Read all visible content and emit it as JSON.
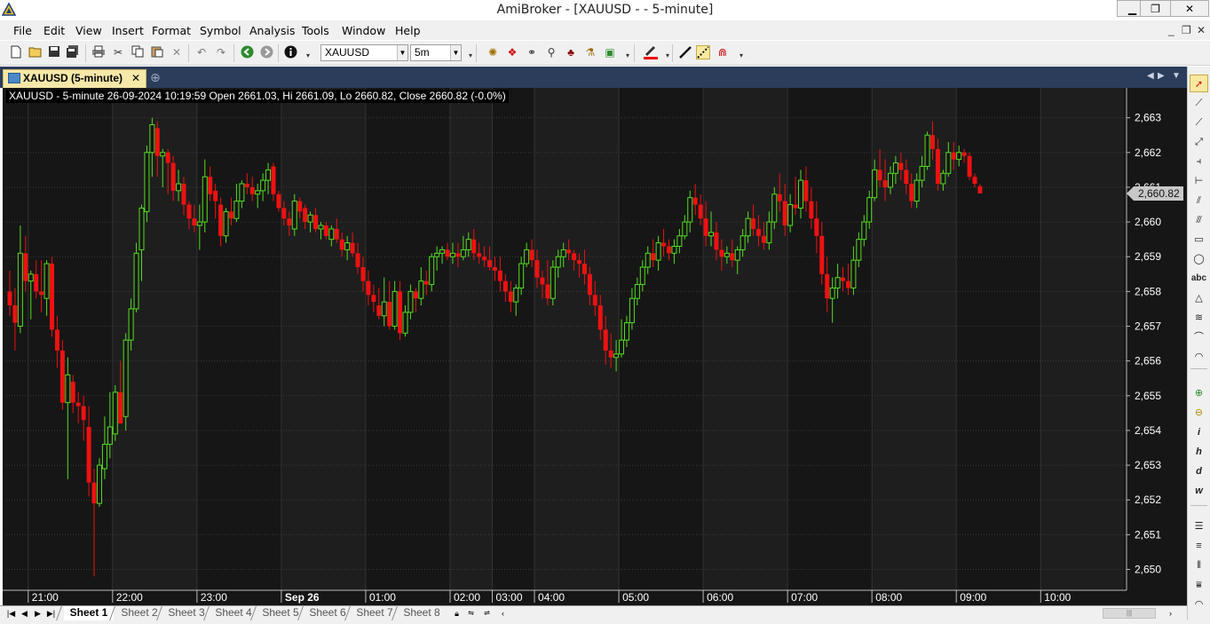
{
  "window": {
    "title": "AmiBroker - [XAUUSD -  - 5-minute]",
    "minimize": "▁",
    "restore": "❐",
    "close": "✕"
  },
  "menu": {
    "items": [
      "File",
      "Edit",
      "View",
      "Insert",
      "Format",
      "Symbol",
      "Analysis",
      "Tools",
      "Window",
      "Help"
    ],
    "mdi_minimize": "_",
    "mdi_restore": "❐",
    "mdi_close": "✕"
  },
  "toolbar": {
    "symbol": "XAUUSD",
    "interval": "5m"
  },
  "tabs": {
    "active_label": "XAUUSD (5-minute)",
    "close": "✕",
    "add": "⊕"
  },
  "chart_header": {
    "ohlc": "XAUUSD - 5-minute 26-09-2024 10:19:59 Open 2661.03, Hi 2661.09, Lo 2660.82, Close 2660.82 (-0.0%)"
  },
  "chart_data": {
    "type": "candlestick",
    "symbol": "XAUUSD",
    "interval": "5-minute",
    "ylim": [
      2649.4,
      2663.4
    ],
    "yticks": [
      2650,
      2651,
      2652,
      2653,
      2654,
      2655,
      2656,
      2657,
      2658,
      2659,
      2660,
      2661,
      2662,
      2663
    ],
    "ytick_labels": [
      "2,650",
      "2,651",
      "2,652",
      "2,653",
      "2,654",
      "2,655",
      "2,656",
      "2,657",
      "2,658",
      "2,659",
      "2,660",
      "2,661",
      "2,662",
      "2,663"
    ],
    "last_price_label": "2,660.82",
    "last_price": 2660.82,
    "xtick_labels": [
      "21:00",
      "22:00",
      "23:00",
      "Sep 26",
      "01:00",
      "02:00",
      "03:00",
      "04:00",
      "05:00",
      "06:00",
      "07:00",
      "08:00",
      "09:00",
      "10:00"
    ],
    "xtick_bar_index": [
      4,
      20,
      36,
      52,
      68,
      84,
      92,
      100,
      116,
      132,
      148,
      164,
      180,
      196
    ],
    "up_color": "#55dd22",
    "down_color": "#ee1111",
    "background": "#161616",
    "grid": true,
    "candles": [
      [
        2658.0,
        2658.6,
        2657.3,
        2657.6
      ],
      [
        2657.6,
        2658.1,
        2656.3,
        2657.1
      ],
      [
        2657.0,
        2659.9,
        2656.8,
        2659.1
      ],
      [
        2659.1,
        2659.6,
        2658.0,
        2658.3
      ],
      [
        2658.3,
        2658.6,
        2657.2,
        2658.5
      ],
      [
        2658.5,
        2658.9,
        2657.8,
        2658.0
      ],
      [
        2658.0,
        2658.9,
        2657.4,
        2657.9
      ],
      [
        2657.8,
        2658.9,
        2657.3,
        2658.8
      ],
      [
        2658.8,
        2659.0,
        2656.7,
        2656.9
      ],
      [
        2656.9,
        2657.3,
        2655.8,
        2656.3
      ],
      [
        2656.3,
        2656.6,
        2654.6,
        2654.8
      ],
      [
        2654.8,
        2656.1,
        2652.6,
        2655.6
      ],
      [
        2655.4,
        2655.6,
        2654.5,
        2654.8
      ],
      [
        2654.8,
        2655.1,
        2654.2,
        2654.7
      ],
      [
        2654.7,
        2655.0,
        2653.7,
        2654.3
      ],
      [
        2654.1,
        2654.7,
        2652.1,
        2652.5
      ],
      [
        2652.5,
        2652.9,
        2649.8,
        2651.9
      ],
      [
        2651.9,
        2653.2,
        2651.8,
        2653.0
      ],
      [
        2652.9,
        2654.4,
        2652.6,
        2653.6
      ],
      [
        2653.6,
        2655.1,
        2653.2,
        2654.1
      ],
      [
        2653.9,
        2655.3,
        2653.7,
        2655.1
      ],
      [
        2655.1,
        2656.0,
        2654.2,
        2654.2
      ],
      [
        2654.4,
        2656.8,
        2654.0,
        2656.6
      ],
      [
        2656.6,
        2657.8,
        2656.3,
        2657.5
      ],
      [
        2657.5,
        2659.4,
        2657.4,
        2659.1
      ],
      [
        2659.2,
        2660.5,
        2658.3,
        2660.4
      ],
      [
        2660.3,
        2662.2,
        2660.0,
        2662.0
      ],
      [
        2662.0,
        2663.0,
        2661.3,
        2662.8
      ],
      [
        2662.7,
        2662.9,
        2661.3,
        2661.9
      ],
      [
        2661.9,
        2662.1,
        2661.0,
        2662.0
      ],
      [
        2662.0,
        2662.1,
        2660.8,
        2661.7
      ],
      [
        2661.7,
        2661.9,
        2660.6,
        2660.9
      ],
      [
        2660.9,
        2661.5,
        2660.6,
        2661.1
      ],
      [
        2661.1,
        2661.3,
        2660.2,
        2660.5
      ],
      [
        2660.5,
        2660.6,
        2659.8,
        2660.1
      ],
      [
        2660.1,
        2660.5,
        2659.7,
        2659.9
      ],
      [
        2659.9,
        2660.5,
        2659.2,
        2660.0
      ],
      [
        2660.0,
        2661.8,
        2659.7,
        2661.3
      ],
      [
        2661.3,
        2661.6,
        2660.6,
        2660.8
      ],
      [
        2660.9,
        2661.1,
        2660.1,
        2660.6
      ],
      [
        2660.5,
        2660.7,
        2659.3,
        2659.6
      ],
      [
        2659.6,
        2660.4,
        2659.4,
        2660.3
      ],
      [
        2660.3,
        2660.7,
        2659.9,
        2660.1
      ],
      [
        2660.1,
        2661.1,
        2660.0,
        2660.6
      ],
      [
        2660.6,
        2661.2,
        2660.4,
        2661.1
      ],
      [
        2661.1,
        2661.4,
        2660.8,
        2661.0
      ],
      [
        2661.0,
        2661.3,
        2660.6,
        2660.8
      ],
      [
        2660.8,
        2661.1,
        2660.4,
        2660.9
      ],
      [
        2660.9,
        2661.4,
        2660.6,
        2661.2
      ],
      [
        2661.2,
        2661.7,
        2660.8,
        2661.5
      ],
      [
        2661.6,
        2661.7,
        2660.6,
        2660.8
      ],
      [
        2660.8,
        2660.9,
        2660.3,
        2660.4
      ],
      [
        2660.4,
        2660.6,
        2659.9,
        2660.1
      ],
      [
        2660.1,
        2660.3,
        2659.6,
        2659.9
      ],
      [
        2659.8,
        2660.8,
        2659.6,
        2660.6
      ],
      [
        2660.6,
        2660.7,
        2660.1,
        2660.3
      ],
      [
        2660.4,
        2660.5,
        2659.8,
        2660.0
      ],
      [
        2660.0,
        2660.3,
        2659.7,
        2660.2
      ],
      [
        2660.2,
        2660.4,
        2659.7,
        2659.8
      ],
      [
        2659.8,
        2660.0,
        2659.5,
        2659.9
      ],
      [
        2659.9,
        2660.0,
        2659.5,
        2659.6
      ],
      [
        2659.5,
        2659.9,
        2659.3,
        2659.8
      ],
      [
        2659.8,
        2660.1,
        2659.4,
        2659.5
      ],
      [
        2659.5,
        2659.7,
        2659.0,
        2659.2
      ],
      [
        2659.2,
        2659.6,
        2658.9,
        2659.4
      ],
      [
        2659.4,
        2659.7,
        2659.0,
        2659.1
      ],
      [
        2659.1,
        2659.4,
        2658.5,
        2658.7
      ],
      [
        2658.7,
        2659.0,
        2658.0,
        2658.3
      ],
      [
        2658.3,
        2658.6,
        2657.6,
        2657.9
      ],
      [
        2657.9,
        2658.2,
        2657.4,
        2657.7
      ],
      [
        2657.6,
        2658.1,
        2657.2,
        2657.3
      ],
      [
        2657.3,
        2658.4,
        2657.0,
        2657.7
      ],
      [
        2657.7,
        2658.3,
        2656.9,
        2657.0
      ],
      [
        2657.0,
        2658.3,
        2656.9,
        2658.0
      ],
      [
        2658.0,
        2658.3,
        2656.6,
        2656.8
      ],
      [
        2656.8,
        2657.6,
        2656.7,
        2657.4
      ],
      [
        2657.4,
        2658.2,
        2657.2,
        2658.0
      ],
      [
        2658.0,
        2658.1,
        2657.4,
        2657.8
      ],
      [
        2657.8,
        2658.7,
        2657.6,
        2658.3
      ],
      [
        2658.3,
        2658.6,
        2657.9,
        2658.2
      ],
      [
        2658.2,
        2659.1,
        2658.0,
        2659.0
      ],
      [
        2659.0,
        2659.3,
        2658.6,
        2659.1
      ],
      [
        2659.1,
        2659.3,
        2658.8,
        2659.2
      ],
      [
        2659.2,
        2659.4,
        2658.9,
        2659.0
      ],
      [
        2659.0,
        2659.4,
        2658.8,
        2659.1
      ],
      [
        2659.1,
        2659.4,
        2658.7,
        2659.0
      ],
      [
        2659.0,
        2659.6,
        2658.9,
        2659.2
      ],
      [
        2659.2,
        2659.7,
        2659.0,
        2659.5
      ],
      [
        2659.5,
        2659.8,
        2658.9,
        2659.1
      ],
      [
        2659.1,
        2659.4,
        2658.8,
        2659.0
      ],
      [
        2659.0,
        2659.3,
        2658.7,
        2658.9
      ],
      [
        2658.9,
        2659.3,
        2658.6,
        2658.7
      ],
      [
        2658.7,
        2659.0,
        2658.3,
        2658.6
      ],
      [
        2658.6,
        2659.0,
        2658.0,
        2658.3
      ],
      [
        2658.3,
        2658.5,
        2657.7,
        2658.0
      ],
      [
        2658.0,
        2658.3,
        2657.4,
        2657.7
      ],
      [
        2657.7,
        2658.2,
        2657.3,
        2658.1
      ],
      [
        2658.1,
        2659.0,
        2657.9,
        2658.8
      ],
      [
        2658.8,
        2659.4,
        2658.7,
        2659.2
      ],
      [
        2659.2,
        2659.5,
        2658.7,
        2658.9
      ],
      [
        2658.9,
        2659.2,
        2658.1,
        2658.4
      ],
      [
        2658.4,
        2658.6,
        2657.8,
        2658.2
      ],
      [
        2658.2,
        2658.9,
        2657.6,
        2657.8
      ],
      [
        2657.8,
        2658.9,
        2657.6,
        2658.7
      ],
      [
        2658.7,
        2659.2,
        2658.4,
        2659.0
      ],
      [
        2659.0,
        2659.4,
        2658.7,
        2659.2
      ],
      [
        2659.2,
        2659.5,
        2658.9,
        2659.1
      ],
      [
        2659.1,
        2659.2,
        2658.6,
        2658.9
      ],
      [
        2658.9,
        2659.1,
        2658.4,
        2658.8
      ],
      [
        2658.8,
        2659.2,
        2658.2,
        2658.5
      ],
      [
        2658.5,
        2658.7,
        2657.6,
        2657.9
      ],
      [
        2657.9,
        2658.3,
        2657.3,
        2657.6
      ],
      [
        2657.6,
        2657.9,
        2656.6,
        2656.9
      ],
      [
        2656.9,
        2657.3,
        2655.9,
        2656.3
      ],
      [
        2656.3,
        2656.8,
        2655.8,
        2656.1
      ],
      [
        2656.1,
        2656.6,
        2655.7,
        2656.2
      ],
      [
        2656.2,
        2657.2,
        2656.1,
        2656.6
      ],
      [
        2656.6,
        2657.3,
        2656.4,
        2657.1
      ],
      [
        2657.1,
        2658.1,
        2656.9,
        2657.8
      ],
      [
        2657.8,
        2658.4,
        2657.6,
        2658.2
      ],
      [
        2658.2,
        2658.9,
        2658.0,
        2658.7
      ],
      [
        2658.7,
        2659.3,
        2658.5,
        2659.1
      ],
      [
        2659.1,
        2659.5,
        2658.7,
        2658.9
      ],
      [
        2658.9,
        2659.6,
        2658.6,
        2659.4
      ],
      [
        2659.4,
        2659.8,
        2659.0,
        2659.3
      ],
      [
        2659.3,
        2659.5,
        2658.9,
        2659.1
      ],
      [
        2659.1,
        2659.5,
        2658.8,
        2659.3
      ],
      [
        2659.3,
        2659.8,
        2659.1,
        2659.6
      ],
      [
        2659.6,
        2660.2,
        2659.5,
        2660.0
      ],
      [
        2660.0,
        2660.9,
        2659.7,
        2660.7
      ],
      [
        2660.7,
        2661.1,
        2660.2,
        2660.5
      ],
      [
        2660.5,
        2660.8,
        2659.9,
        2660.1
      ],
      [
        2660.1,
        2660.6,
        2659.3,
        2659.6
      ],
      [
        2659.6,
        2660.3,
        2659.3,
        2659.7
      ],
      [
        2659.7,
        2660.0,
        2658.9,
        2659.2
      ],
      [
        2659.2,
        2659.5,
        2658.6,
        2659.0
      ],
      [
        2659.0,
        2659.3,
        2658.8,
        2659.1
      ],
      [
        2659.1,
        2659.5,
        2658.7,
        2658.9
      ],
      [
        2658.9,
        2659.3,
        2658.5,
        2659.2
      ],
      [
        2659.2,
        2659.8,
        2659.0,
        2659.6
      ],
      [
        2659.6,
        2660.3,
        2659.4,
        2660.1
      ],
      [
        2660.1,
        2660.5,
        2659.6,
        2659.8
      ],
      [
        2659.8,
        2660.2,
        2659.3,
        2659.6
      ],
      [
        2659.6,
        2660.0,
        2659.2,
        2659.4
      ],
      [
        2659.4,
        2660.3,
        2659.2,
        2660.0
      ],
      [
        2660.0,
        2661.0,
        2659.8,
        2660.8
      ],
      [
        2660.8,
        2661.4,
        2660.3,
        2660.6
      ],
      [
        2660.6,
        2661.1,
        2659.6,
        2659.9
      ],
      [
        2659.9,
        2660.8,
        2659.7,
        2660.5
      ],
      [
        2660.5,
        2661.3,
        2660.2,
        2660.4
      ],
      [
        2660.4,
        2661.5,
        2660.1,
        2661.2
      ],
      [
        2661.2,
        2661.6,
        2660.3,
        2660.6
      ],
      [
        2660.6,
        2661.0,
        2659.8,
        2660.1
      ],
      [
        2660.1,
        2660.6,
        2659.1,
        2659.6
      ],
      [
        2659.6,
        2660.0,
        2658.2,
        2658.5
      ],
      [
        2658.5,
        2659.0,
        2657.4,
        2657.8
      ],
      [
        2657.8,
        2658.4,
        2657.1,
        2658.1
      ],
      [
        2658.1,
        2658.8,
        2657.8,
        2658.4
      ],
      [
        2658.4,
        2658.7,
        2658.0,
        2658.3
      ],
      [
        2658.3,
        2658.8,
        2657.9,
        2658.1
      ],
      [
        2658.1,
        2659.3,
        2657.9,
        2658.9
      ],
      [
        2658.9,
        2659.7,
        2658.7,
        2659.5
      ],
      [
        2659.5,
        2660.2,
        2659.3,
        2660.0
      ],
      [
        2660.0,
        2660.9,
        2659.8,
        2660.7
      ],
      [
        2660.7,
        2661.8,
        2660.6,
        2661.5
      ],
      [
        2661.5,
        2662.1,
        2661.0,
        2661.2
      ],
      [
        2661.2,
        2661.8,
        2660.6,
        2661.0
      ],
      [
        2661.0,
        2661.6,
        2660.8,
        2661.4
      ],
      [
        2661.4,
        2661.9,
        2661.1,
        2661.7
      ],
      [
        2661.7,
        2662.0,
        2661.2,
        2661.5
      ],
      [
        2661.5,
        2661.8,
        2660.8,
        2661.1
      ],
      [
        2661.1,
        2661.4,
        2660.4,
        2660.6
      ],
      [
        2660.6,
        2661.4,
        2660.4,
        2661.2
      ],
      [
        2661.2,
        2661.9,
        2661.0,
        2661.6
      ],
      [
        2661.6,
        2662.6,
        2661.5,
        2662.5
      ],
      [
        2662.5,
        2662.9,
        2661.8,
        2662.1
      ],
      [
        2662.1,
        2662.4,
        2660.9,
        2661.1
      ],
      [
        2661.1,
        2661.5,
        2660.9,
        2661.4
      ],
      [
        2661.4,
        2662.3,
        2661.3,
        2662.0
      ],
      [
        2662.0,
        2662.3,
        2661.5,
        2661.8
      ],
      [
        2661.8,
        2662.2,
        2661.6,
        2662.0
      ],
      [
        2662.0,
        2662.1,
        2661.7,
        2661.9
      ],
      [
        2661.9,
        2662.0,
        2661.2,
        2661.3
      ],
      [
        2661.3,
        2661.4,
        2661.0,
        2661.1
      ],
      [
        2661.03,
        2661.09,
        2660.82,
        2660.82
      ]
    ]
  },
  "sheets": {
    "items": [
      "Sheet 1",
      "Sheet 2",
      "Sheet 3",
      "Sheet 4",
      "Sheet 5",
      "Sheet 6",
      "Sheet 7",
      "Sheet 8"
    ],
    "active": "Sheet 1"
  },
  "drawing_tools": {
    "text_tool": "abc",
    "info_i": "i",
    "info_h": "h",
    "info_d": "d",
    "info_w": "w"
  }
}
